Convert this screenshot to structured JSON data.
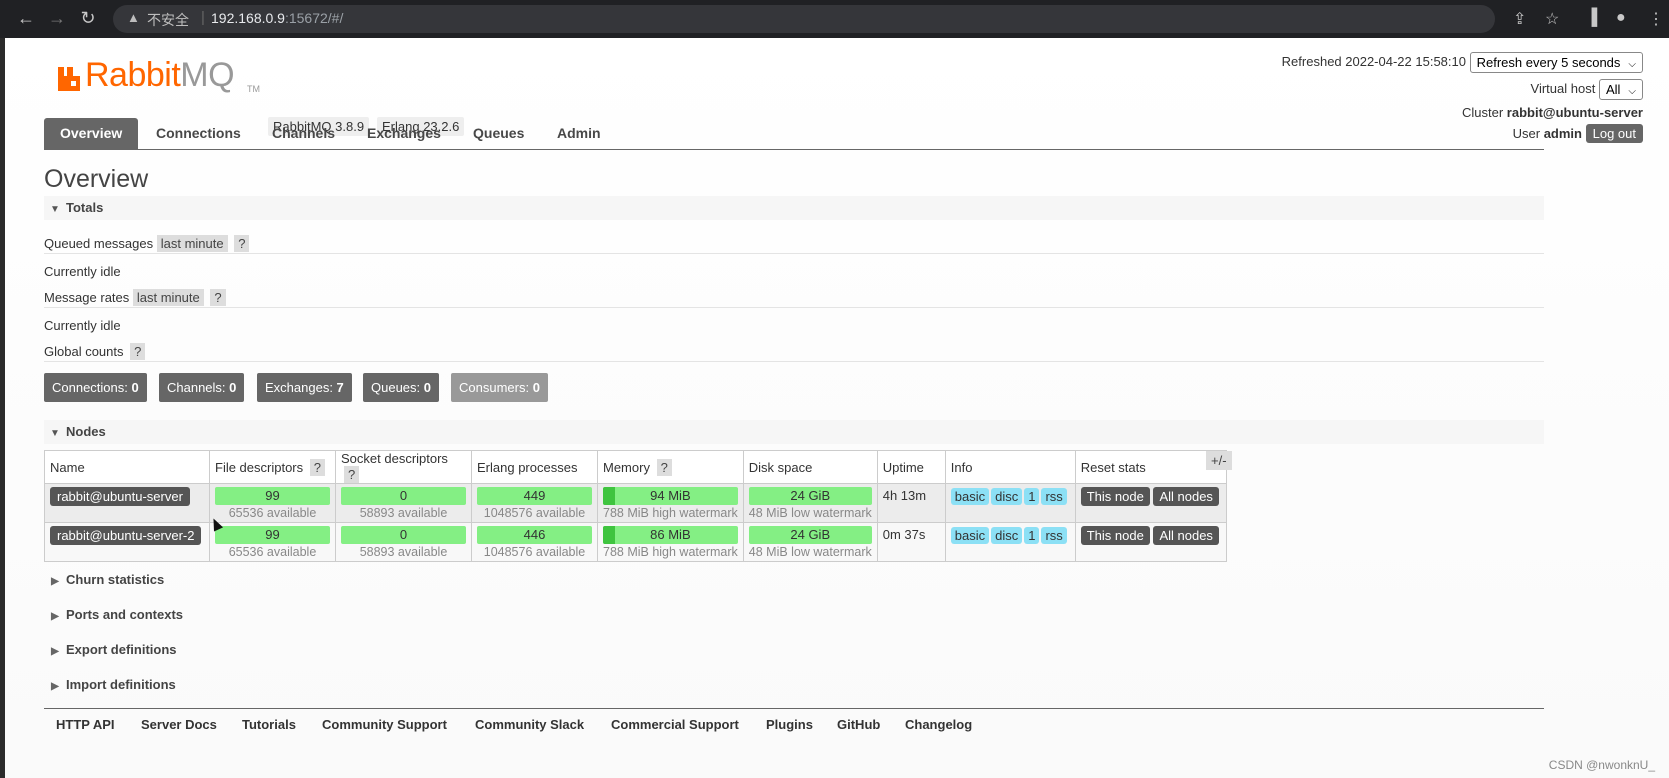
{
  "browser": {
    "insecure_label": "不安全",
    "url_host": "192.168.0.9",
    "url_path": ":15672/#/",
    "back_glyph": "←",
    "forward_glyph": "→",
    "reload_glyph": "↻",
    "warning_glyph": "▲",
    "share_glyph": "⇪",
    "star_glyph": "☆",
    "sidepanel_glyph": "▐",
    "profile_glyph": "●",
    "menu_glyph": "⋮"
  },
  "header": {
    "logo_text_rabbit": "Rabbit",
    "logo_text_mq": "MQ",
    "logo_tm": "TM",
    "rabbitmq_version": "RabbitMQ 3.8.9",
    "erlang_version": "Erlang 23.2.6",
    "refreshed_label": "Refreshed 2022-04-22 15:58:10",
    "refresh_select": "Refresh every 5 seconds",
    "vhost_label": "Virtual host",
    "vhost_select": "All",
    "cluster_label": "Cluster",
    "cluster_name": "rabbit@ubuntu-server",
    "user_label": "User",
    "user_name": "admin",
    "logout_label": "Log out"
  },
  "tabs": [
    "Overview",
    "Connections",
    "Channels",
    "Exchanges",
    "Queues",
    "Admin"
  ],
  "page_title": "Overview",
  "totals": {
    "title": "Totals",
    "queued_label": "Queued messages",
    "queued_range": "last minute",
    "help": "?",
    "idle1": "Currently idle",
    "rates_label": "Message rates",
    "rates_range": "last minute",
    "idle2": "Currently idle",
    "global_label": "Global counts",
    "counts": [
      {
        "label": "Connections: ",
        "value": "0"
      },
      {
        "label": "Channels: ",
        "value": "0"
      },
      {
        "label": "Exchanges: ",
        "value": "7"
      },
      {
        "label": "Queues: ",
        "value": "0"
      },
      {
        "label": "Consumers: ",
        "value": "0"
      }
    ]
  },
  "nodes": {
    "title": "Nodes",
    "plusminus": "+/-",
    "headers": [
      "Name",
      "File descriptors",
      "Socket descriptors",
      "Erlang processes",
      "Memory",
      "Disk space",
      "Uptime",
      "Info",
      "Reset stats"
    ],
    "rows": [
      {
        "name": "rabbit@ubuntu-server",
        "fd": "99",
        "fd_avail": "65536 available",
        "sd": "0",
        "sd_avail": "58893 available",
        "ep": "449",
        "ep_avail": "1048576 available",
        "mem": "94 MiB",
        "mem_wm": "788 MiB high watermark",
        "disk": "24 GiB",
        "disk_wm": "48 MiB low watermark",
        "uptime": "4h 13m",
        "info": [
          "basic",
          "disc",
          "1",
          "rss"
        ],
        "btn_this": "This node",
        "btn_all": "All nodes"
      },
      {
        "name": "rabbit@ubuntu-server-2",
        "fd": "99",
        "fd_avail": "65536 available",
        "sd": "0",
        "sd_avail": "58893 available",
        "ep": "446",
        "ep_avail": "1048576 available",
        "mem": "86 MiB",
        "mem_wm": "788 MiB high watermark",
        "disk": "24 GiB",
        "disk_wm": "48 MiB low watermark",
        "uptime": "0m 37s",
        "info": [
          "basic",
          "disc",
          "1",
          "rss"
        ],
        "btn_this": "This node",
        "btn_all": "All nodes"
      }
    ]
  },
  "folds": [
    "Churn statistics",
    "Ports and contexts",
    "Export definitions",
    "Import definitions"
  ],
  "footer_links": [
    "HTTP API",
    "Server Docs",
    "Tutorials",
    "Community Support",
    "Community Slack",
    "Commercial Support",
    "Plugins",
    "GitHub",
    "Changelog"
  ],
  "watermark": "CSDN @nwonknU_",
  "colors": {
    "brand": "#ff6600",
    "bar_green": "#84ef84",
    "info_tag": "#8ce0f5"
  }
}
